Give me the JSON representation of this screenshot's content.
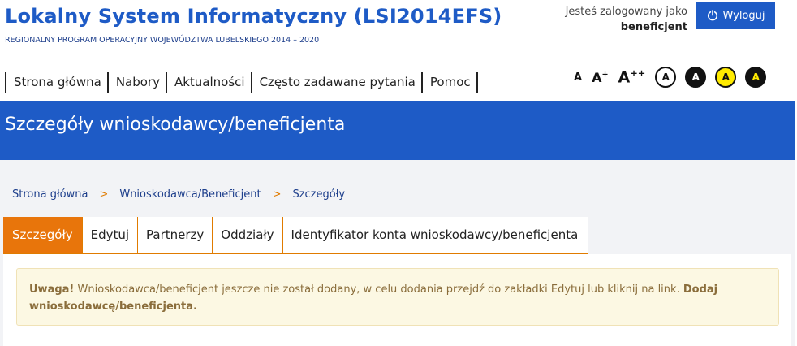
{
  "header": {
    "title": "Lokalny System Informatyczny (LSI2014EFS)",
    "subtitle": "REGIONALNY PROGRAM OPERACYJNY WOJEWÓDZTWA LUBELSKIEGO 2014 – 2020",
    "login_label": "Jesteś zalogowany jako",
    "login_user": "beneficjent",
    "logout_label": "Wyloguj"
  },
  "nav": {
    "items": [
      "Strona główna",
      "Nabory",
      "Aktualności",
      "Często zadawane pytania",
      "Pomoc"
    ]
  },
  "accessibility": {
    "font_sizes": [
      "A",
      "A+",
      "A++"
    ],
    "contrast": [
      "A",
      "A",
      "A",
      "A"
    ]
  },
  "page": {
    "title": "Szczegóły wnioskodawcy/beneficjenta"
  },
  "breadcrumb": {
    "items": [
      "Strona główna",
      "Wnioskodawca/Beneficjent",
      "Szczegóły"
    ],
    "separator": ">"
  },
  "tabs": [
    "Szczegóły",
    "Edytuj",
    "Partnerzy",
    "Oddziały",
    "Identyfikator konta wnioskodawcy/beneficjenta"
  ],
  "alert": {
    "strong": "Uwaga!",
    "text": " Wnioskodawca/beneficjent jeszcze nie został dodany, w celu dodania przejdź do zakładki Edytuj lub kliknij na link. ",
    "link": "Dodaj wnioskodawcę/beneficjenta."
  },
  "colors": {
    "brand_blue": "#1e5bc6",
    "accent_orange": "#e8750b",
    "alert_bg": "#fcf8e3"
  }
}
